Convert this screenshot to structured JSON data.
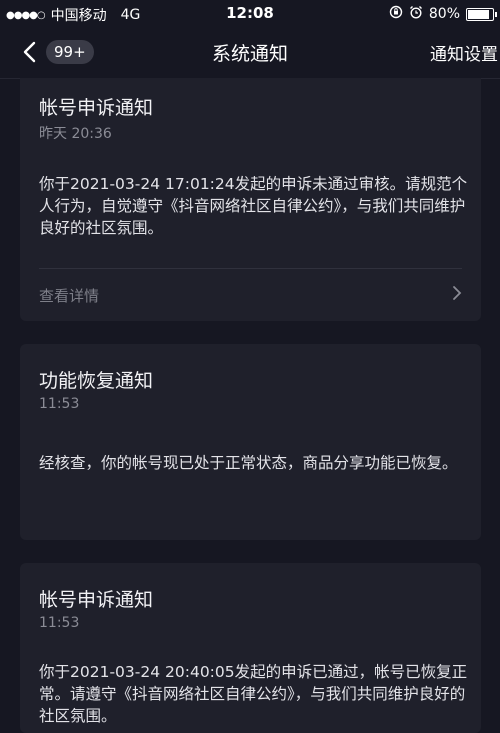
{
  "status_bar": {
    "signal_dots": "●●●●○",
    "carrier": "中国移动",
    "network": "4G",
    "time": "12:08",
    "battery_percent": "80%",
    "battery_level": 0.8,
    "icons": [
      "signal-icon",
      "rotation-lock-icon",
      "alarm-icon",
      "battery-icon"
    ]
  },
  "nav": {
    "badge": "99+",
    "title": "系统通知",
    "settings": "通知设置",
    "icons": [
      "back-arrow-icon"
    ]
  },
  "notifications": [
    {
      "title": "帐号申诉通知",
      "time": "昨天 20:36",
      "body": "你于2021-03-24 17:01:24发起的申诉未通过审核。请规范个人行为，自觉遵守《抖音网络社区自律公约》，与我们共同维护良好的社区氛围。",
      "details": "查看详情"
    },
    {
      "title": "功能恢复通知",
      "time": "11:53",
      "body": "经核查，你的帐号现已处于正常状态，商品分享功能已恢复。"
    },
    {
      "title": "帐号申诉通知",
      "time": "11:53",
      "body": "你于2021-03-24 20:40:05发起的申诉已通过，帐号已恢复正常。请遵守《抖音网络社区自律公约》，与我们共同维护良好的社区氛围。"
    }
  ],
  "colors": {
    "background": "#161722",
    "card": "#1f202b",
    "text": "#e3e3e8",
    "muted": "#8b8c96"
  }
}
